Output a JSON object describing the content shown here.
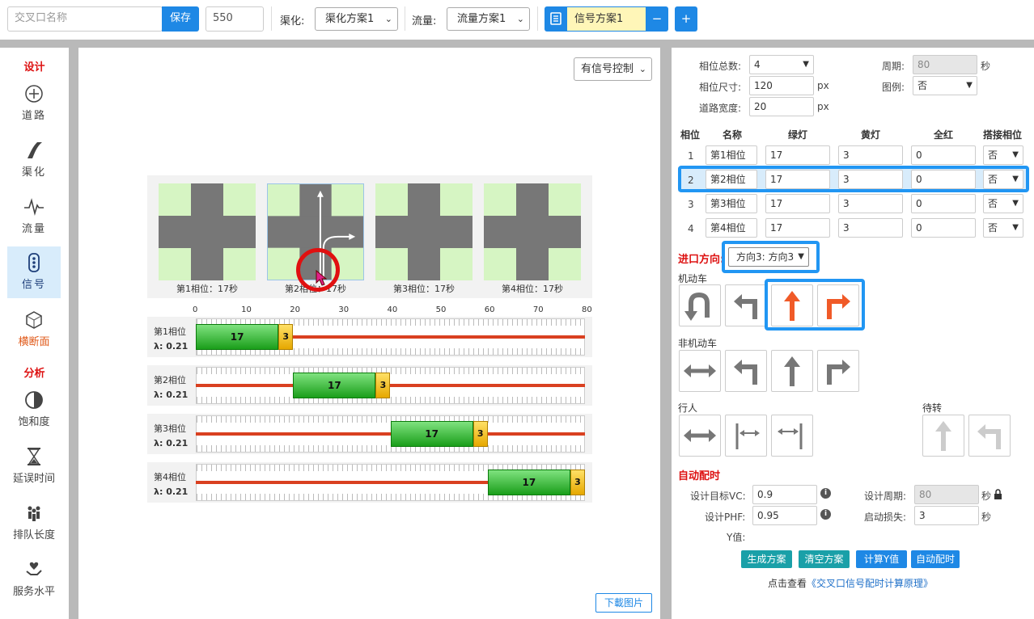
{
  "toolbar": {
    "name_placeholder": "交叉口名称",
    "save_label": "保存",
    "size_value": "550",
    "channel_label": "渠化:",
    "channel_value": "渠化方案1",
    "flow_label": "流量:",
    "flow_value": "流量方案1",
    "signal_value": "信号方案1",
    "minus_label": "−",
    "plus_label": "+"
  },
  "sidebar": {
    "design_title": "设计",
    "analysis_title": "分析",
    "items": [
      {
        "label": "道路",
        "icon": "crosshair-icon"
      },
      {
        "label": "渠化",
        "icon": "curve-road-icon"
      },
      {
        "label": "流量",
        "icon": "pulse-icon"
      },
      {
        "label": "信号",
        "icon": "traffic-light-icon"
      },
      {
        "label": "横断面",
        "icon": "hexagon-icon"
      },
      {
        "label": "饱和度",
        "icon": "half-circle-icon"
      },
      {
        "label": "延误时间",
        "icon": "hourglass-icon"
      },
      {
        "label": "排队长度",
        "icon": "people-icon"
      },
      {
        "label": "服务水平",
        "icon": "hand-heart-icon"
      }
    ]
  },
  "canvas": {
    "control_select": "有信号控制",
    "download_label": "下載图片",
    "phase_captions": [
      "第1相位：17秒",
      "第2相位：17秒",
      "第3相位：17秒",
      "第4相位：17秒"
    ],
    "ticks": [
      "0",
      "10",
      "20",
      "30",
      "40",
      "50",
      "60",
      "70",
      "80"
    ],
    "lanes": [
      {
        "name": "第1相位",
        "lambda": "λ:  0.21",
        "green": "17",
        "yellow": "3",
        "start": 0
      },
      {
        "name": "第2相位",
        "lambda": "λ:  0.21",
        "green": "17",
        "yellow": "3",
        "start": 20
      },
      {
        "name": "第3相位",
        "lambda": "λ:  0.21",
        "green": "17",
        "yellow": "3",
        "start": 40
      },
      {
        "name": "第4相位",
        "lambda": "λ:  0.21",
        "green": "17",
        "yellow": "3",
        "start": 60
      }
    ]
  },
  "panel": {
    "phase_total_label": "相位总数:",
    "phase_total_value": "4",
    "cycle_label": "周期:",
    "cycle_value": "80",
    "sec_unit": "秒",
    "phase_size_label": "相位尺寸:",
    "phase_size_value": "120",
    "px_unit": "px",
    "legend_label": "图例:",
    "legend_value": "否",
    "road_width_label": "道路宽度:",
    "road_width_value": "20",
    "table_headers": [
      "相位",
      "名称",
      "绿灯",
      "黄灯",
      "全红",
      "搭接相位"
    ],
    "rows": [
      {
        "idx": "1",
        "name": "第1相位",
        "green": "17",
        "yellow": "3",
        "red": "0",
        "overlap": "否"
      },
      {
        "idx": "2",
        "name": "第2相位",
        "green": "17",
        "yellow": "3",
        "red": "0",
        "overlap": "否"
      },
      {
        "idx": "3",
        "name": "第3相位",
        "green": "17",
        "yellow": "3",
        "red": "0",
        "overlap": "否"
      },
      {
        "idx": "4",
        "name": "第4相位",
        "green": "17",
        "yellow": "3",
        "red": "0",
        "overlap": "否"
      }
    ],
    "approach_label": "进口方向:",
    "approach_value": "方向3: 方向3",
    "motor_label": "机动车",
    "nonmotor_label": "非机动车",
    "ped_label": "行人",
    "wait_label": "待转",
    "auto_title": "自动配时",
    "target_vc_label": "设计目标VC:",
    "target_vc_value": "0.9",
    "design_cycle_label": "设计周期:",
    "design_cycle_value": "80",
    "phf_label": "设计PHF:",
    "phf_value": "0.95",
    "startup_label": "启动损失:",
    "startup_value": "3",
    "y_label": "Y值:",
    "btn_generate": "生成方案",
    "btn_clear": "清空方案",
    "btn_calc": "计算Y值",
    "btn_auto": "自动配时",
    "footer_prefix": "点击查看",
    "footer_link": "《交叉口信号配时计算原理》"
  },
  "colors": {
    "accent": "#1e88e5",
    "highlight": "#2196f3",
    "active_arrow": "#f05a28",
    "green_area": "#d6f5c3",
    "road": "#777777"
  }
}
